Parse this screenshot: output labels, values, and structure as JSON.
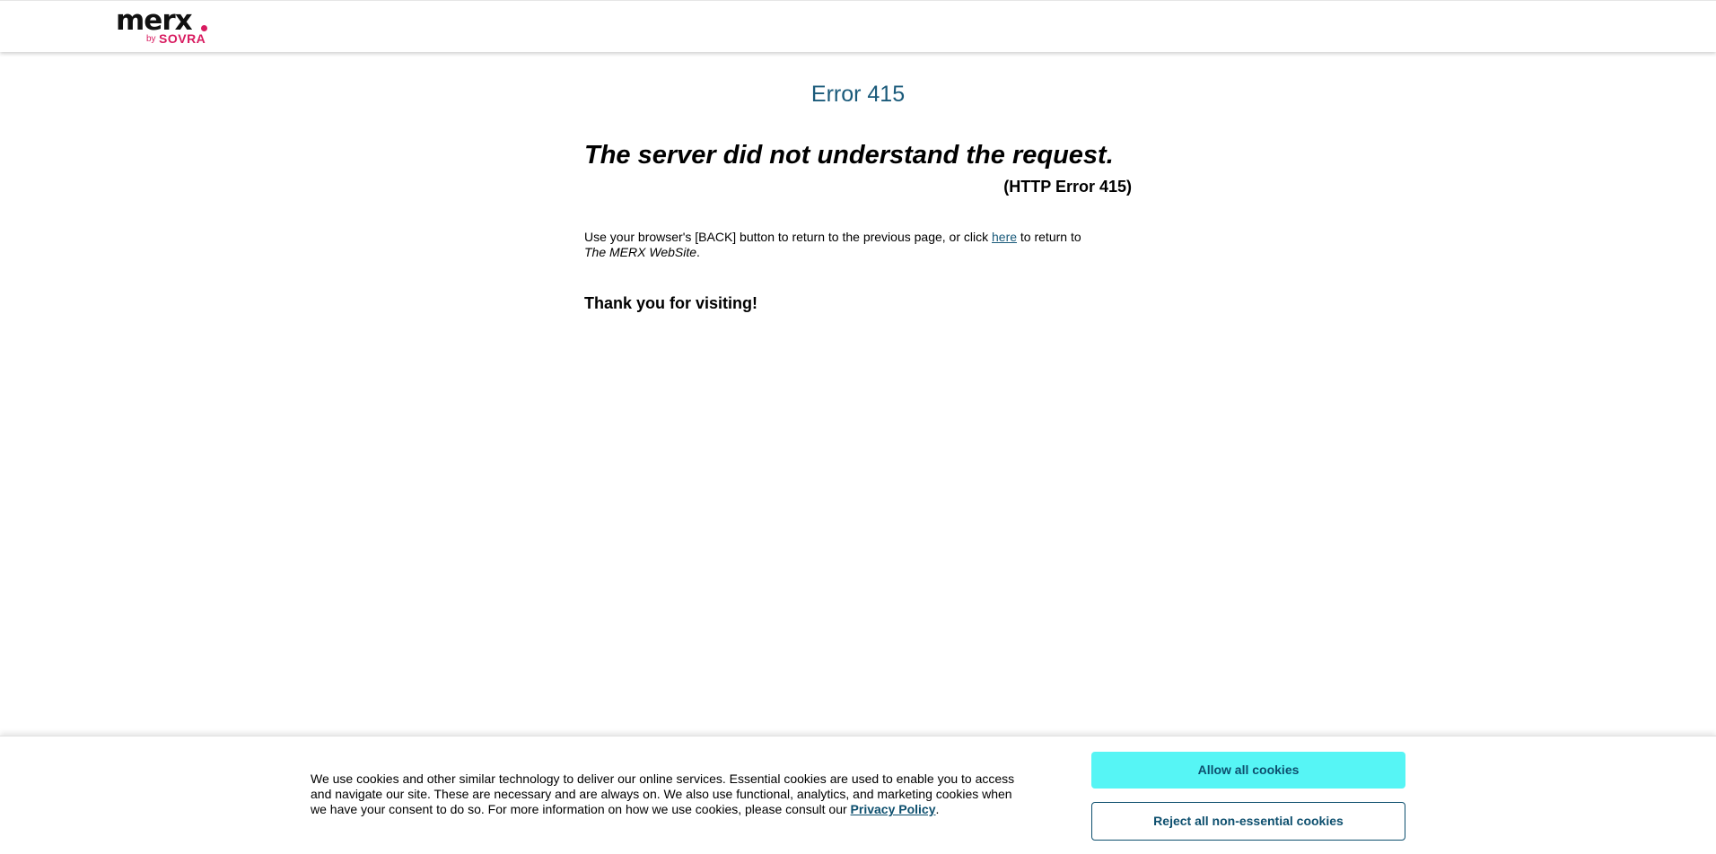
{
  "header": {
    "logo": {
      "main": "merx",
      "by": "by",
      "brand": "SOVRA"
    }
  },
  "main": {
    "error_code": "Error 415",
    "headline": "The server did not understand the request.",
    "http_error": "(HTTP Error 415)",
    "instructions": {
      "before_link": "Use your browser's [BACK] button to return to the previous page, or click ",
      "link_text": "here",
      "after_link": " to return to",
      "site_name": "The MERX WebSite",
      "period": "."
    },
    "thanks": "Thank you for visiting!"
  },
  "cookie_banner": {
    "text": "We use cookies and other similar technology to deliver our online services. Essential cookies are used to enable you to access and navigate our site. These are necessary and are always on. We also use functional, analytics, and marketing cookies when we have your consent to do so. For more information on how we use cookies, please consult our ",
    "privacy_link": "Privacy Policy",
    "period": ".",
    "allow_button": "Allow all cookies",
    "reject_button": "Reject all non-essential cookies"
  },
  "colors": {
    "accent": "#1a5a7a",
    "brand_pink": "#d81b60",
    "allow_button_bg": "#56f5f5"
  }
}
